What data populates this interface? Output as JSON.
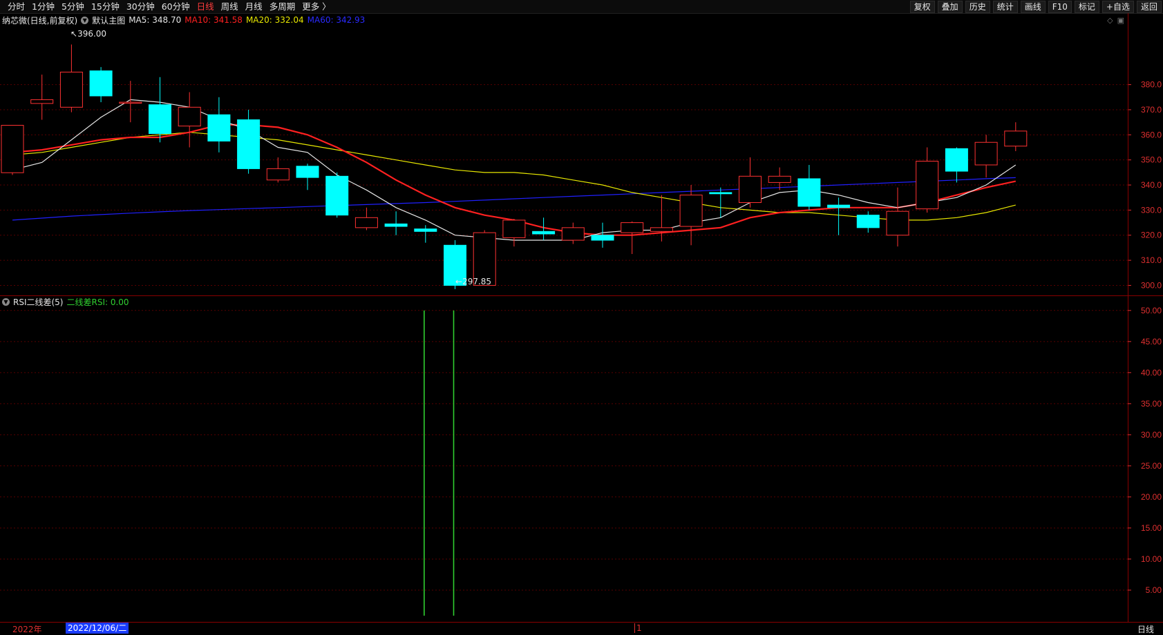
{
  "toolbar": {
    "periods": [
      "分时",
      "1分钟",
      "5分钟",
      "15分钟",
      "30分钟",
      "60分钟",
      "日线",
      "周线",
      "月线",
      "多周期",
      "更多 〉"
    ],
    "active_period": "日线",
    "buttons": [
      "复权",
      "叠加",
      "历史",
      "统计",
      "画线",
      "F10",
      "标记",
      "+自选",
      "返回"
    ]
  },
  "main_info": {
    "stock": "纳芯微(日线,前复权)",
    "template": "默认主图",
    "ma5": "MA5: 348.70",
    "ma10": "MA10: 341.58",
    "ma20": "MA20: 332.04",
    "ma60": "MA60: 342.93"
  },
  "colors": {
    "ma5": "#e6e6e6",
    "ma10": "#ff2020",
    "ma20": "#e8e800",
    "ma60": "#2020ff",
    "up": "#ff3232",
    "down": "#00ffff",
    "rsi_line": "#30d030",
    "axis": "#e03030"
  },
  "price_axis": [
    "380.0",
    "370.0",
    "360.0",
    "350.0",
    "340.0",
    "330.0",
    "320.0",
    "310.0",
    "300.0"
  ],
  "annotations": {
    "high": "396.00",
    "low": "297.85"
  },
  "rsi_info": {
    "title": "RSI二线差(5)",
    "value": "二线差RSI: 0.00"
  },
  "rsi_axis": [
    "50.00",
    "45.00",
    "40.00",
    "35.00",
    "30.00",
    "25.00",
    "20.00",
    "15.00",
    "10.00",
    "5.00"
  ],
  "bottom": {
    "year": "2022年",
    "cursor_date": "2022/12/06/二",
    "month": "1",
    "period": "日线"
  },
  "chart_data": {
    "type": "candlestick",
    "price_ylim": [
      296,
      403
    ],
    "candles": [
      {
        "o": 344.9,
        "h": 362.0,
        "l": 344.0,
        "c": 363.8
      },
      {
        "o": 372.5,
        "h": 384.0,
        "l": 366.0,
        "c": 374.0
      },
      {
        "o": 371.0,
        "h": 396.0,
        "l": 369.0,
        "c": 385.0
      },
      {
        "o": 385.5,
        "h": 387.0,
        "l": 373.0,
        "c": 375.5
      },
      {
        "o": 373.0,
        "h": 381.5,
        "l": 365.0,
        "c": 373.0
      },
      {
        "o": 372.0,
        "h": 383.0,
        "l": 357.0,
        "c": 360.5
      },
      {
        "o": 363.5,
        "h": 377.0,
        "l": 355.0,
        "c": 371.0
      },
      {
        "o": 368.0,
        "h": 375.0,
        "l": 353.0,
        "c": 357.5
      },
      {
        "o": 366.0,
        "h": 370.0,
        "l": 344.5,
        "c": 346.5
      },
      {
        "o": 342.0,
        "h": 351.0,
        "l": 341.0,
        "c": 346.5
      },
      {
        "o": 347.5,
        "h": 348.5,
        "l": 338.0,
        "c": 343.0
      },
      {
        "o": 343.5,
        "h": 345.0,
        "l": 327.0,
        "c": 328.0
      },
      {
        "o": 323.0,
        "h": 331.0,
        "l": 322.0,
        "c": 327.0
      },
      {
        "o": 324.5,
        "h": 329.5,
        "l": 320.0,
        "c": 323.5
      },
      {
        "o": 322.5,
        "h": 324.0,
        "l": 317.0,
        "c": 321.5
      },
      {
        "o": 316.0,
        "h": 318.0,
        "l": 298.5,
        "c": 300.0
      },
      {
        "o": 300.0,
        "h": 322.0,
        "l": 300.0,
        "c": 321.0
      },
      {
        "o": 319.0,
        "h": 326.5,
        "l": 315.5,
        "c": 326.0
      },
      {
        "o": 321.5,
        "h": 327.0,
        "l": 318.0,
        "c": 320.5
      },
      {
        "o": 318.0,
        "h": 325.0,
        "l": 316.5,
        "c": 323.0
      },
      {
        "o": 320.0,
        "h": 325.0,
        "l": 315.0,
        "c": 318.0
      },
      {
        "o": 321.0,
        "h": 325.5,
        "l": 312.5,
        "c": 325.0
      },
      {
        "o": 321.5,
        "h": 336.0,
        "l": 317.5,
        "c": 323.0
      },
      {
        "o": 323.5,
        "h": 340.0,
        "l": 316.0,
        "c": 336.0
      },
      {
        "o": 337.0,
        "h": 339.0,
        "l": 327.0,
        "c": 336.5
      },
      {
        "o": 333.0,
        "h": 351.0,
        "l": 331.0,
        "c": 343.5
      },
      {
        "o": 341.0,
        "h": 347.0,
        "l": 338.0,
        "c": 343.5
      },
      {
        "o": 342.5,
        "h": 348.0,
        "l": 330.0,
        "c": 331.5
      },
      {
        "o": 332.0,
        "h": 335.0,
        "l": 320.0,
        "c": 331.0
      },
      {
        "o": 328.0,
        "h": 329.5,
        "l": 321.0,
        "c": 323.0
      },
      {
        "o": 320.0,
        "h": 339.0,
        "l": 315.5,
        "c": 329.5
      },
      {
        "o": 330.5,
        "h": 355.0,
        "l": 329.0,
        "c": 349.5
      },
      {
        "o": 354.5,
        "h": 355.0,
        "l": 341.0,
        "c": 345.5
      },
      {
        "o": 348.0,
        "h": 360.0,
        "l": 343.0,
        "c": 357.0
      },
      {
        "o": 355.5,
        "h": 365.0,
        "l": 353.5,
        "c": 361.5
      }
    ],
    "ma5": [
      346,
      349,
      358,
      367,
      374,
      373,
      371,
      366,
      362,
      355,
      353,
      344,
      338,
      331,
      326,
      320,
      319,
      318,
      318,
      318,
      321,
      322,
      322,
      325,
      327,
      333,
      337,
      338,
      336,
      333,
      331,
      333,
      335,
      340,
      348
    ],
    "ma10": [
      353,
      354,
      356,
      358,
      359,
      359,
      361,
      364,
      364,
      363,
      360,
      355,
      349,
      342,
      336,
      331,
      328,
      326,
      323,
      321,
      320,
      320,
      321,
      322,
      323,
      327,
      329,
      330,
      331,
      331,
      331,
      333,
      336,
      339,
      341.5
    ],
    "ma20": [
      352,
      353,
      355,
      357,
      359,
      360,
      361,
      360,
      359,
      358,
      356,
      354,
      352,
      350,
      348,
      346,
      345,
      345,
      344,
      342,
      340,
      337,
      335,
      333,
      331,
      330,
      329,
      329,
      328,
      327,
      326,
      326,
      327,
      329,
      332
    ],
    "ma60": [
      326,
      326.8,
      327.6,
      328.2,
      328.8,
      329.3,
      329.8,
      330.2,
      330.6,
      331.0,
      331.4,
      331.8,
      332.2,
      332.6,
      333.0,
      333.5,
      334.0,
      334.5,
      335.0,
      335.5,
      336.0,
      336.5,
      337.0,
      337.5,
      338.0,
      338.5,
      339.0,
      339.5,
      340.0,
      340.5,
      341.0,
      341.5,
      342.0,
      342.5,
      342.93
    ],
    "rsi_ylim": [
      0,
      52.2
    ],
    "rsi_spikes": [
      {
        "index": 14,
        "value": 50
      },
      {
        "index": 15,
        "value": 50
      }
    ]
  }
}
